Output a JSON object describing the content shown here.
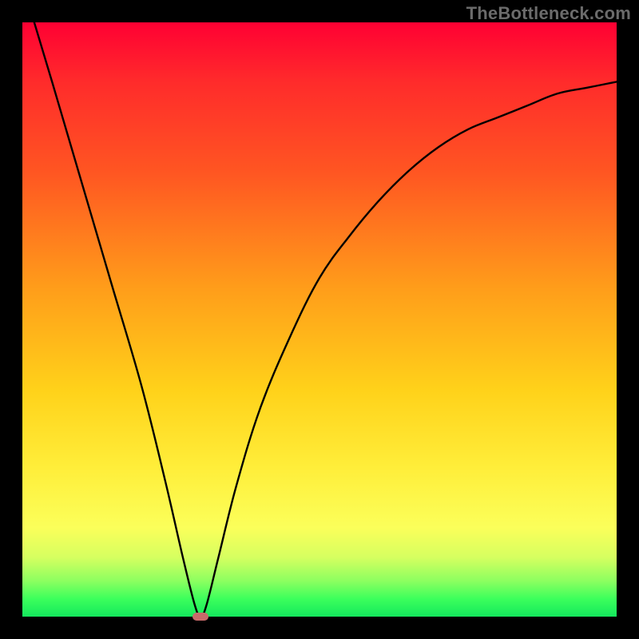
{
  "watermark": {
    "text": "TheBottleneck.com"
  },
  "chart_data": {
    "type": "line",
    "title": "",
    "xlabel": "",
    "ylabel": "",
    "xlim": [
      0,
      100
    ],
    "ylim": [
      0,
      100
    ],
    "grid": false,
    "legend": false,
    "background": "rainbow-gradient-red-to-green-vertical",
    "curve_points": [
      {
        "x": 2,
        "y": 100
      },
      {
        "x": 5,
        "y": 90
      },
      {
        "x": 10,
        "y": 73
      },
      {
        "x": 15,
        "y": 56
      },
      {
        "x": 20,
        "y": 39
      },
      {
        "x": 24,
        "y": 23
      },
      {
        "x": 27,
        "y": 10
      },
      {
        "x": 29,
        "y": 2
      },
      {
        "x": 30,
        "y": 0
      },
      {
        "x": 31,
        "y": 2
      },
      {
        "x": 33,
        "y": 10
      },
      {
        "x": 36,
        "y": 22
      },
      {
        "x": 40,
        "y": 35
      },
      {
        "x": 45,
        "y": 47
      },
      {
        "x": 50,
        "y": 57
      },
      {
        "x": 55,
        "y": 64
      },
      {
        "x": 60,
        "y": 70
      },
      {
        "x": 65,
        "y": 75
      },
      {
        "x": 70,
        "y": 79
      },
      {
        "x": 75,
        "y": 82
      },
      {
        "x": 80,
        "y": 84
      },
      {
        "x": 85,
        "y": 86
      },
      {
        "x": 90,
        "y": 88
      },
      {
        "x": 95,
        "y": 89
      },
      {
        "x": 100,
        "y": 90
      }
    ],
    "minimum_marker": {
      "x": 30,
      "y": 0,
      "shape": "pill",
      "color": "#c86a6a"
    }
  }
}
